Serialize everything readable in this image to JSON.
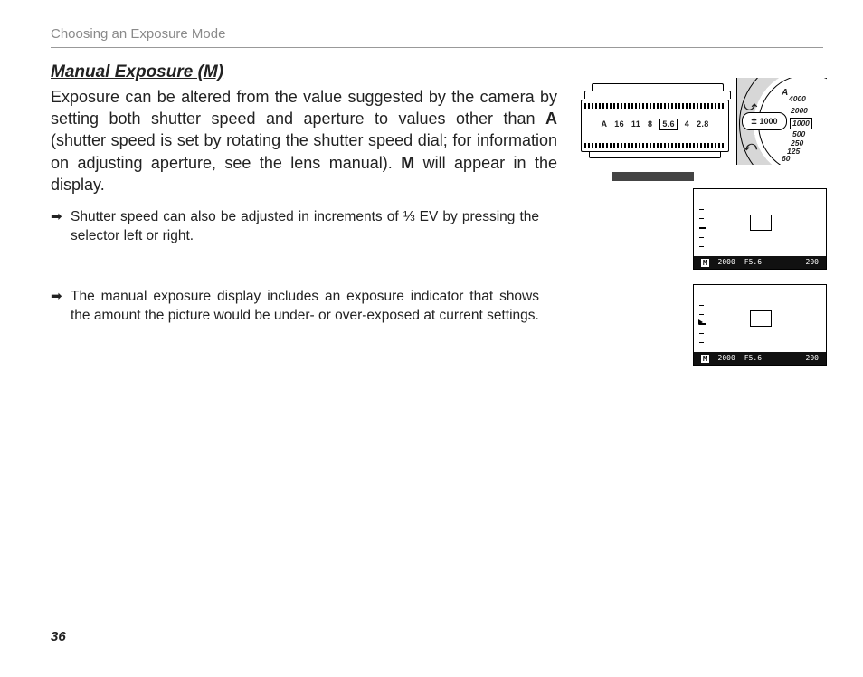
{
  "running_head": "Choosing an Exposure Mode",
  "heading": "Manual Exposure (M)",
  "body": {
    "p1a": "Exposure can be altered from the value suggested by the camera by setting both shutter speed and aperture to values other than ",
    "p1_boldA": "A",
    "p1b": " (shutter speed is set by rotating the shutter speed dial; for information on adjusting aperture, see the lens manual).  ",
    "p1_boldM": "M",
    "p1c": " will appear in the display."
  },
  "bullets": [
    "Shutter speed can also be adjusted in increments of ⅓ EV by pressing the selector left or right.",
    "The manual exposure display includes an exposure indicator that shows the amount the picture would be under- or over-exposed at current settings."
  ],
  "page_number": "36",
  "lens": {
    "scale": [
      "A",
      "16",
      "11",
      "8",
      "5.6",
      "4",
      "2.8"
    ],
    "selected": "5.6"
  },
  "dial": {
    "values": [
      "A",
      "4000",
      "2000",
      "1000",
      "500",
      "250",
      "125",
      "60"
    ],
    "selected": "1000"
  },
  "evf": {
    "mode": "M",
    "shutter": "2000",
    "aperture": "F5.6",
    "iso": "200"
  }
}
